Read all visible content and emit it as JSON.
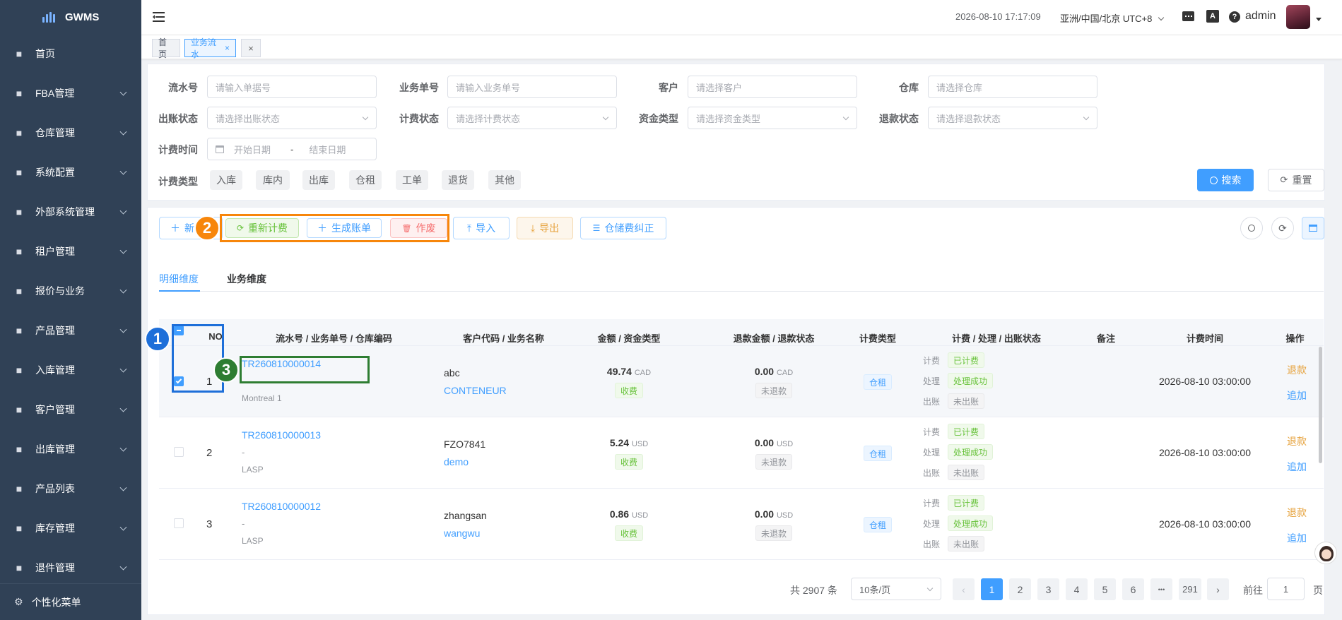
{
  "app": {
    "name": "GWMS"
  },
  "sidebar": {
    "items": [
      {
        "label": "首页",
        "icon": "dashboard-icon",
        "arrow": false
      },
      {
        "label": "FBA管理",
        "icon": "fba-icon",
        "arrow": true
      },
      {
        "label": "仓库管理",
        "icon": "globe-icon",
        "arrow": true
      },
      {
        "label": "系统配置",
        "icon": "config-icon",
        "arrow": true
      },
      {
        "label": "外部系统管理",
        "icon": "grid-icon",
        "arrow": true
      },
      {
        "label": "租户管理",
        "icon": "bar-chart-icon",
        "arrow": true
      },
      {
        "label": "报价与业务",
        "icon": "document-icon",
        "arrow": true
      },
      {
        "label": "产品管理",
        "icon": "cart-icon",
        "arrow": true
      },
      {
        "label": "入库管理",
        "icon": "home-icon",
        "arrow": true
      },
      {
        "label": "客户管理",
        "icon": "user-icon",
        "arrow": true
      },
      {
        "label": "出库管理",
        "icon": "grid-icon",
        "arrow": true
      },
      {
        "label": "产品列表",
        "icon": "book-icon",
        "arrow": true
      },
      {
        "label": "库存管理",
        "icon": "table-icon",
        "arrow": true
      },
      {
        "label": "退件管理",
        "icon": "document-icon",
        "arrow": true
      }
    ],
    "footer": "个性化菜单"
  },
  "topbar": {
    "datetime": "2026-08-10 17:17:09",
    "timezone": "亚洲/中国/北京 UTC+8",
    "username": "admin"
  },
  "tags": {
    "home": "首页",
    "current": "业务流水"
  },
  "filters": {
    "serial": {
      "label": "流水号",
      "placeholder": "请输入单据号"
    },
    "bizno": {
      "label": "业务单号",
      "placeholder": "请输入业务单号"
    },
    "customer": {
      "label": "客户",
      "placeholder": "请选择客户"
    },
    "warehouse": {
      "label": "仓库",
      "placeholder": "请选择仓库"
    },
    "billing_status": {
      "label": "出账状态",
      "placeholder": "请选择出账状态"
    },
    "charge_status": {
      "label": "计费状态",
      "placeholder": "请选择计费状态"
    },
    "fund_type": {
      "label": "资金类型",
      "placeholder": "请选择资金类型"
    },
    "refund_status": {
      "label": "退款状态",
      "placeholder": "请选择退款状态"
    },
    "charge_time": {
      "label": "计费时间",
      "start": "开始日期",
      "sep": "-",
      "end": "结束日期"
    },
    "charge_type": {
      "label": "计费类型",
      "chips": [
        "入库",
        "库内",
        "出库",
        "仓租",
        "工单",
        "退货",
        "其他"
      ]
    },
    "search": "搜索",
    "reset": "重置"
  },
  "toolbar": {
    "new": "新",
    "recalc": "重新计费",
    "gen_bill": "生成账单",
    "void": "作废",
    "import": "导入",
    "export": "导出",
    "storage_fix": "仓储费纠正"
  },
  "tabs": [
    "明细维度",
    "业务维度"
  ],
  "table": {
    "headers": {
      "no": "NO",
      "serial": "流水号 / 业务单号 / 仓库编码",
      "customer": "客户代码 / 业务名称",
      "amount": "金额 / 资金类型",
      "refund": "退款金额 / 退款状态",
      "type": "计费类型",
      "status": "计费 / 处理 / 出账状态",
      "remark": "备注",
      "time": "计费时间",
      "ops": "操作"
    },
    "rows": [
      {
        "no": "1",
        "serial": "TR260810000014",
        "bizno": "",
        "warehouse": "Montreal 1",
        "customer_code": "abc",
        "biz_name": "CONTENEUR",
        "amount": "49.74",
        "currency": "CAD",
        "fund_type": "收费",
        "refund_amount": "0.00",
        "refund_currency": "CAD",
        "refund_status": "未退款",
        "charge_type": "仓租",
        "st_charge_lbl": "计费",
        "st_charge": "已计费",
        "st_proc_lbl": "处理",
        "st_proc": "处理成功",
        "st_bill_lbl": "出账",
        "st_bill": "未出账",
        "remark": "",
        "time": "2026-08-10 03:00:00",
        "op_refund": "退款",
        "op_add": "追加",
        "checked": true
      },
      {
        "no": "2",
        "serial": "TR260810000013",
        "bizno": "-",
        "warehouse": "LASP",
        "customer_code": "FZO7841",
        "biz_name": "demo",
        "amount": "5.24",
        "currency": "USD",
        "fund_type": "收费",
        "refund_amount": "0.00",
        "refund_currency": "USD",
        "refund_status": "未退款",
        "charge_type": "仓租",
        "st_charge_lbl": "计费",
        "st_charge": "已计费",
        "st_proc_lbl": "处理",
        "st_proc": "处理成功",
        "st_bill_lbl": "出账",
        "st_bill": "未出账",
        "remark": "",
        "time": "2026-08-10 03:00:00",
        "op_refund": "退款",
        "op_add": "追加",
        "checked": false
      },
      {
        "no": "3",
        "serial": "TR260810000012",
        "bizno": "-",
        "warehouse": "LASP",
        "customer_code": "zhangsan",
        "biz_name": "wangwu",
        "amount": "0.86",
        "currency": "USD",
        "fund_type": "收费",
        "refund_amount": "0.00",
        "refund_currency": "USD",
        "refund_status": "未退款",
        "charge_type": "仓租",
        "st_charge_lbl": "计费",
        "st_charge": "已计费",
        "st_proc_lbl": "处理",
        "st_proc": "处理成功",
        "st_bill_lbl": "出账",
        "st_bill": "未出账",
        "remark": "",
        "time": "2026-08-10 03:00:00",
        "op_refund": "退款",
        "op_add": "追加",
        "checked": false
      }
    ]
  },
  "pagination": {
    "total": "共 2907 条",
    "page_size": "10条/页",
    "pages": [
      "1",
      "2",
      "3",
      "4",
      "5",
      "6"
    ],
    "ellipsis": "•••",
    "last": "291",
    "goto_label": "前往",
    "goto_value": "1",
    "goto_suffix": "页",
    "current": 1
  },
  "callouts": [
    "1",
    "2",
    "3"
  ],
  "colors": {
    "sidebar": "#304156",
    "primary": "#409eff",
    "success": "#67c23a",
    "danger": "#f56c6c",
    "warning": "#e6a23c",
    "callout_blue": "#1e6fd9",
    "callout_orange": "#f7860b",
    "callout_green": "#2e7d32"
  }
}
